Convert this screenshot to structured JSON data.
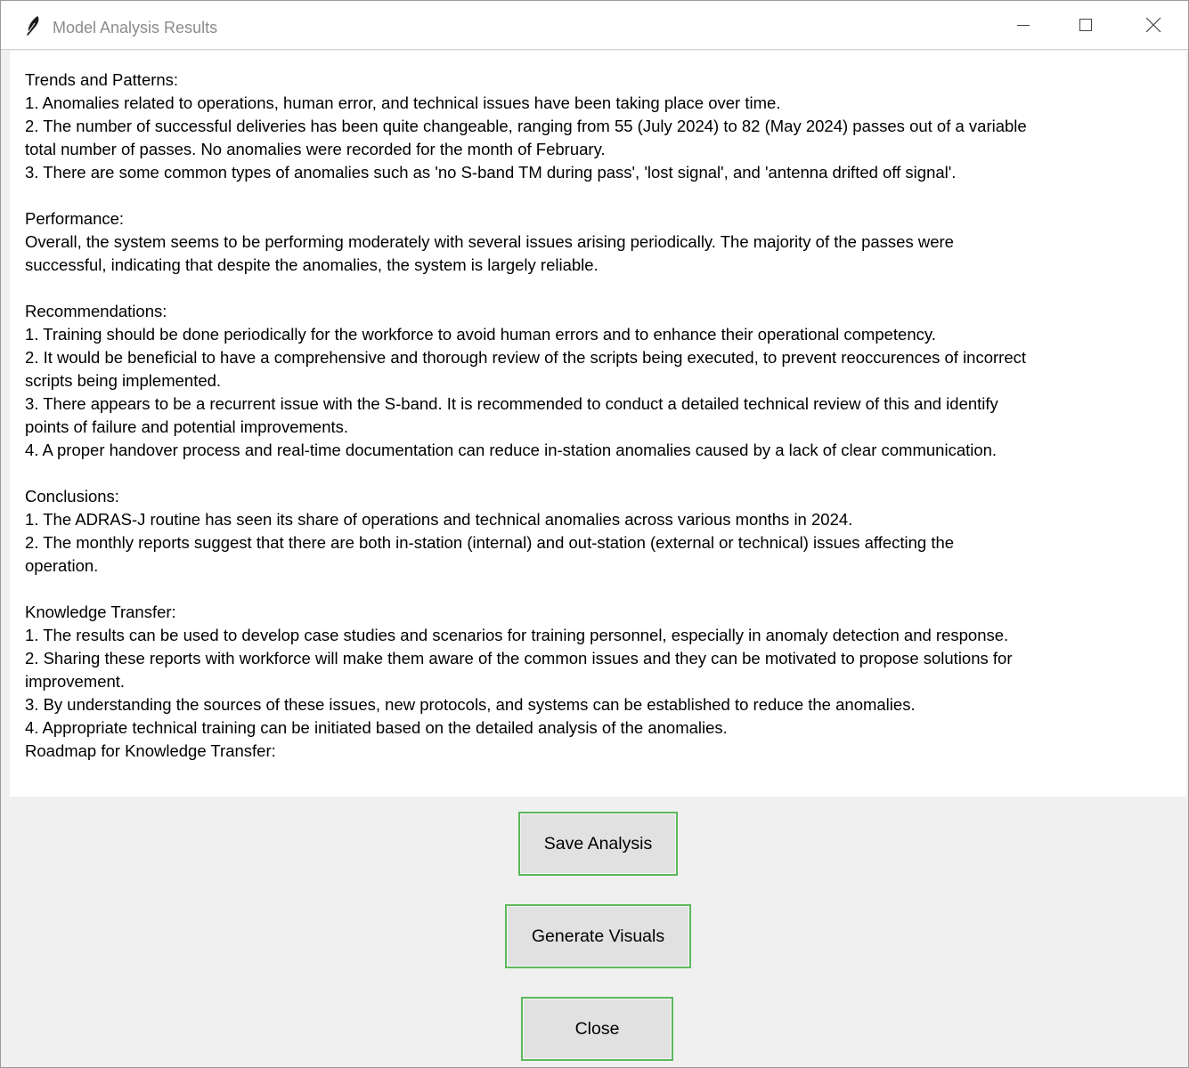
{
  "window": {
    "title": "Model Analysis Results",
    "icon": "feather-icon",
    "controls": [
      "minimize-icon",
      "maximize-icon",
      "close-icon"
    ]
  },
  "analysis": {
    "lines": [
      "Trends and Patterns:",
      "1. Anomalies related to operations, human error, and technical issues have been taking place over time.",
      "2. The number of successful deliveries has been quite changeable, ranging from 55 (July 2024) to 82 (May 2024) passes out of a variable",
      "total number of passes. No anomalies were recorded for the month of February.",
      "3. There are some common types of anomalies such as 'no S-band TM during pass', 'lost signal', and 'antenna drifted off signal'.",
      "",
      "Performance:",
      "Overall, the system seems to be performing moderately with several issues arising periodically. The majority of the passes were",
      "successful, indicating that despite the anomalies, the system is largely reliable.",
      "",
      "Recommendations:",
      "1. Training should be done periodically for the workforce to avoid human errors and to enhance their operational competency.",
      "2. It would be beneficial to have a comprehensive and thorough review of the scripts being executed, to prevent reoccurences of incorrect",
      "scripts being implemented.",
      "3. There appears to be a recurrent issue with the S-band. It is recommended to conduct a detailed technical review of this and identify",
      "points of failure and potential improvements.",
      "4. A proper handover process and real-time documentation can reduce in-station anomalies caused by a lack of clear communication.",
      "",
      "Conclusions:",
      "1. The ADRAS-J routine has seen its share of operations and technical anomalies across various months in 2024.",
      "2. The monthly reports suggest that there are both in-station (internal) and out-station (external or technical) issues affecting the",
      "operation.",
      "",
      "Knowledge Transfer:",
      "1. The results can be used to develop case studies and scenarios for training personnel, especially in anomaly detection and response.",
      "2. Sharing these reports with workforce will make them aware of the common issues and they can be motivated to propose solutions for",
      "improvement.",
      "3. By understanding the sources of these issues, new protocols, and systems can be established to reduce the anomalies.",
      "4. Appropriate technical training can be initiated based on the detailed analysis of the anomalies.",
      "Roadmap for Knowledge Transfer:"
    ]
  },
  "buttons": {
    "save": "Save Analysis",
    "generate": "Generate Visuals",
    "close": "Close"
  },
  "colors": {
    "button_border": "#5cb85c",
    "button_bg": "#e1e1e1",
    "window_bg": "#f0f0f0",
    "title_text": "#8c8c8c"
  }
}
